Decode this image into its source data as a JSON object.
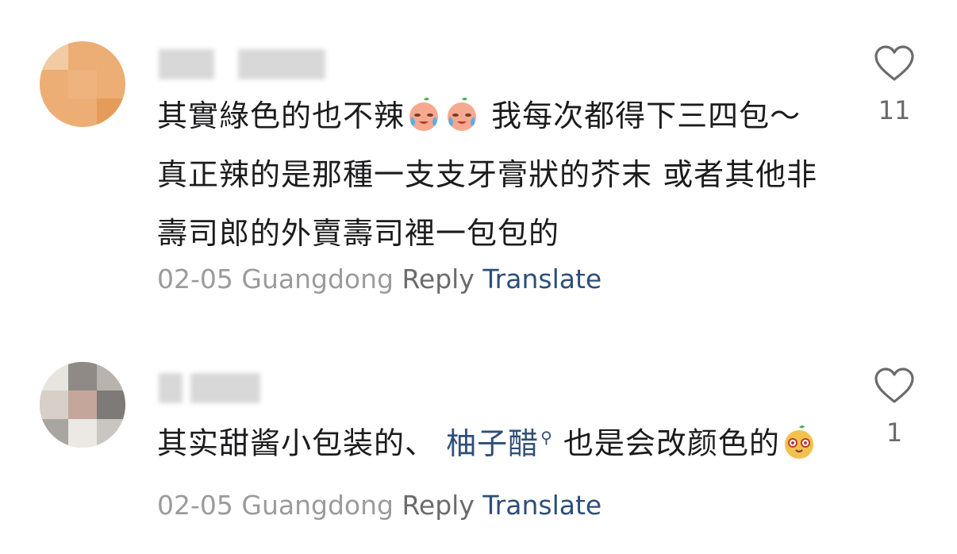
{
  "comments": [
    {
      "text_part1": "其實綠色的也不辣",
      "emoji1": "crying-peach-emoji",
      "text_part2": " 我每次都得下三四包～真正辣的是那種一支支牙膏狀的芥末 或者其他非壽司郎的外賣壽司裡一包包的",
      "date": "02-05",
      "location": "Guangdong",
      "reply_label": "Reply",
      "translate_label": "Translate",
      "likes": "11",
      "avatar_color": "#ECAE74"
    },
    {
      "text_part1": "其实甜酱小包装的、 ",
      "link_text": "柚子醋",
      "link_icon": "search-icon",
      "text_part2": " 也是会改颜色的",
      "emoji": "blushing-peach-emoji",
      "date": "02-05",
      "location": "Guangdong",
      "reply_label": "Reply",
      "translate_label": "Translate",
      "likes": "1",
      "avatar_color": "#C9C2BA"
    }
  ]
}
